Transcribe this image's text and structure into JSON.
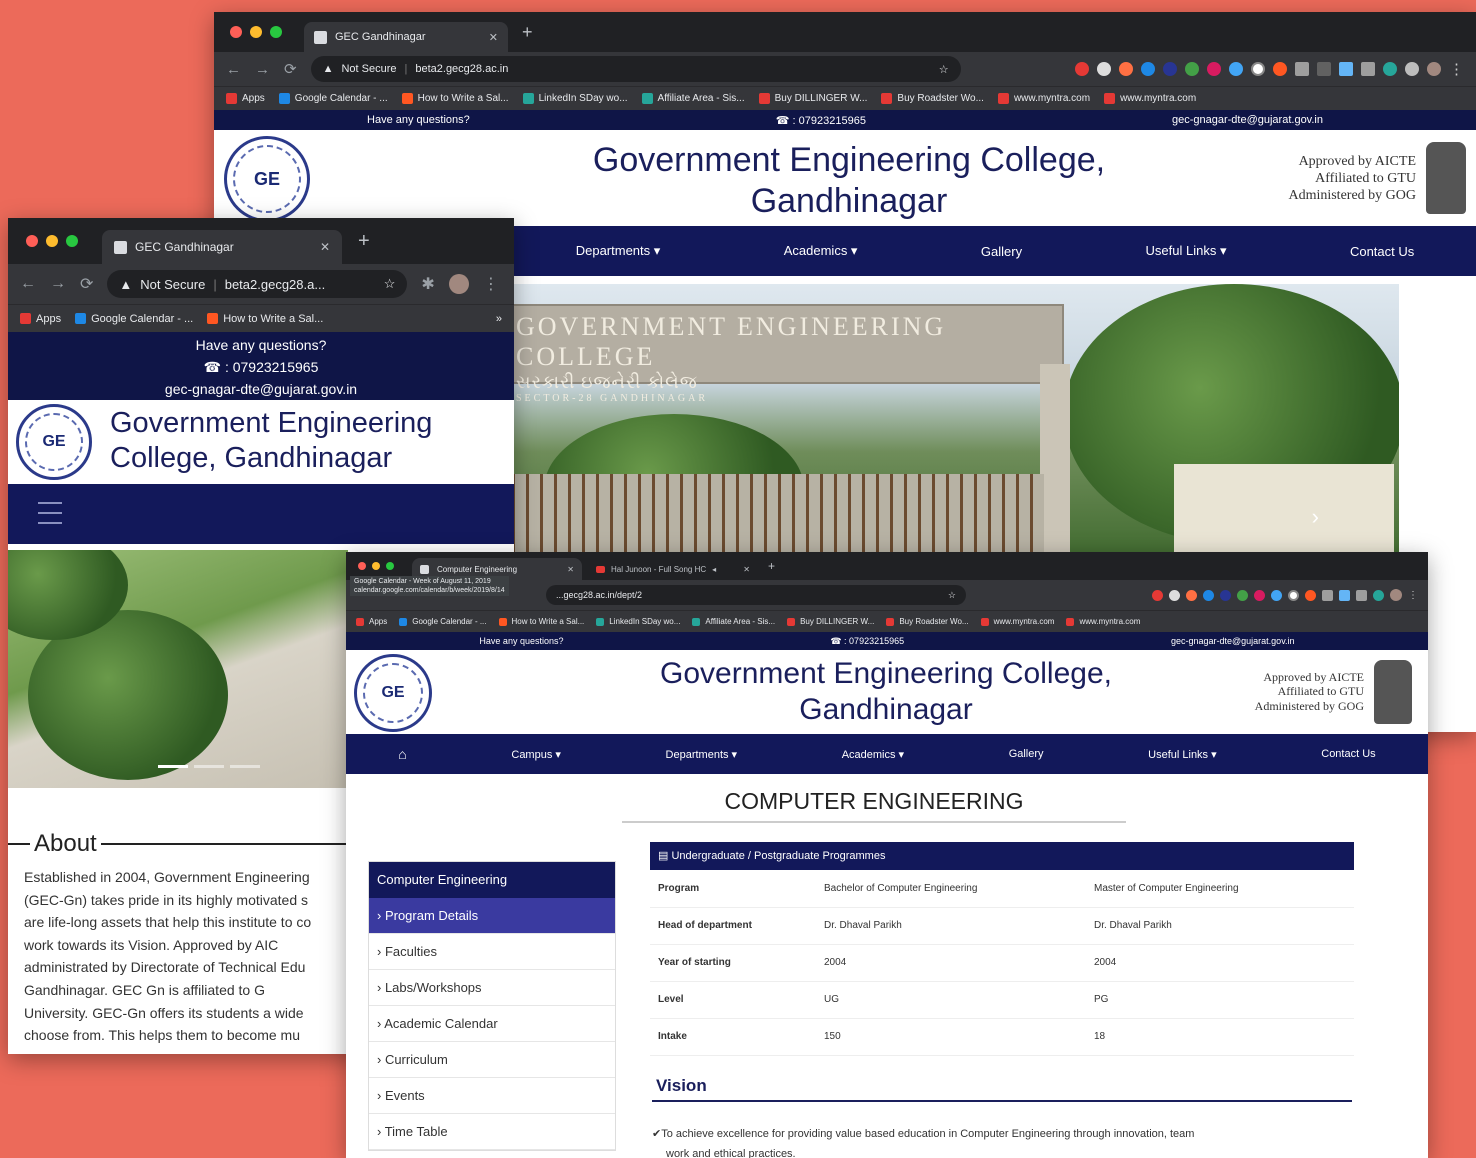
{
  "back_window": {
    "tab_title": "GEC Gandhinagar",
    "address_security": "Not Secure",
    "address_url": "beta2.gecg28.ac.in",
    "bookmarks": [
      "Apps",
      "Google Calendar - ...",
      "How to Write a Sal...",
      "LinkedIn SDay wo...",
      "Affiliate Area - Sis...",
      "Buy DILLINGER W...",
      "Buy Roadster Wo...",
      "www.myntra.com",
      "www.myntra.com"
    ],
    "topbar": {
      "question": "Have any questions?",
      "phone": "☎ : 07923215965",
      "email": "gec-gnagar-dte@gujarat.gov.in"
    },
    "college_title_line1": "Government Engineering College,",
    "college_title_line2": "Gandhinagar",
    "approvals": [
      "Approved by AICTE",
      "Affiliated to GTU",
      "Administered by GOG"
    ],
    "nav": [
      "Departments ▾",
      "Academics ▾",
      "Gallery",
      "Useful Links ▾",
      "Contact Us"
    ],
    "hero_sign_en": "GOVERNMENT ENGINEERING COLLEGE",
    "hero_sign_gu": "સરકારી ઇજનેરી કોલેજ",
    "hero_sign_sub": "SECTOR-28 GANDHINAGAR"
  },
  "mobile_window": {
    "tab_title": "GEC Gandhinagar",
    "address_security": "Not Secure",
    "address_url": "beta2.gecg28.a...",
    "bookmarks": [
      "Apps",
      "Google Calendar - ...",
      "How to Write a Sal..."
    ],
    "topbar": {
      "question": "Have any questions?",
      "phone": "☎ : 07923215965",
      "email": "gec-gnagar-dte@gujarat.gov.in"
    },
    "college_title_line1": "Government Engineering",
    "college_title_line2": "College, Gandhinagar",
    "about_heading": "About",
    "about_lines": [
      "Established in 2004, Government Engineering",
      "(GEC-Gn) takes pride in its highly motivated s",
      "are life-long assets that help this institute to co",
      "work towards its Vision. Approved by AIC",
      "administrated by Directorate of Technical Edu",
      "Gandhinagar. GEC Gn is affiliated to G",
      "University. GEC-Gn offers its students a wide",
      "choose from. This helps them to become mu"
    ]
  },
  "front_window": {
    "tab1_title": "Computer Engineering",
    "tab2_title": "Hal Junoon - Full Song HC",
    "tooltip_line1": "Google Calendar - Week of August 11, 2019",
    "tooltip_line2": "calendar.google.com/calendar/b/week/2019/8/14",
    "address_url": "...gecg28.ac.in/dept/2",
    "bookmarks": [
      "Apps",
      "Google Calendar - ...",
      "How to Write a Sal...",
      "LinkedIn SDay wo...",
      "Affiliate Area - Sis...",
      "Buy DILLINGER W...",
      "Buy Roadster Wo...",
      "www.myntra.com",
      "www.myntra.com"
    ],
    "topbar": {
      "question": "Have any questions?",
      "phone": "☎ : 07923215965",
      "email": "gec-gnagar-dte@gujarat.gov.in"
    },
    "college_title_line1": "Government Engineering College,",
    "college_title_line2": "Gandhinagar",
    "approvals": [
      "Approved by AICTE",
      "Affiliated to GTU",
      "Administered by GOG"
    ],
    "nav": [
      "Campus ▾",
      "Departments ▾",
      "Academics ▾",
      "Gallery",
      "Useful Links ▾",
      "Contact Us"
    ],
    "page_heading": "COMPUTER ENGINEERING",
    "sidebar_title": "Computer Engineering",
    "sidebar_items": [
      "› Program Details",
      "› Faculties",
      "› Labs/Workshops",
      "› Academic Calendar",
      "› Curriculum",
      "› Events",
      "› Time Table"
    ],
    "programmes_header": "▤ Undergraduate / Postgraduate Programmes",
    "programmes": [
      [
        "Program",
        "Bachelor of Computer Engineering",
        "Master of Computer Engineering"
      ],
      [
        "Head of department",
        "Dr. Dhaval Parikh",
        "Dr. Dhaval Parikh"
      ],
      [
        "Year of starting",
        "2004",
        "2004"
      ],
      [
        "Level",
        "UG",
        "PG"
      ],
      [
        "Intake",
        "150",
        "18"
      ]
    ],
    "vision_heading": "Vision",
    "vision_line1": "✔To achieve excellence for providing value based education in Computer Engineering through innovation, team",
    "vision_line2": "work and ethical practices."
  }
}
